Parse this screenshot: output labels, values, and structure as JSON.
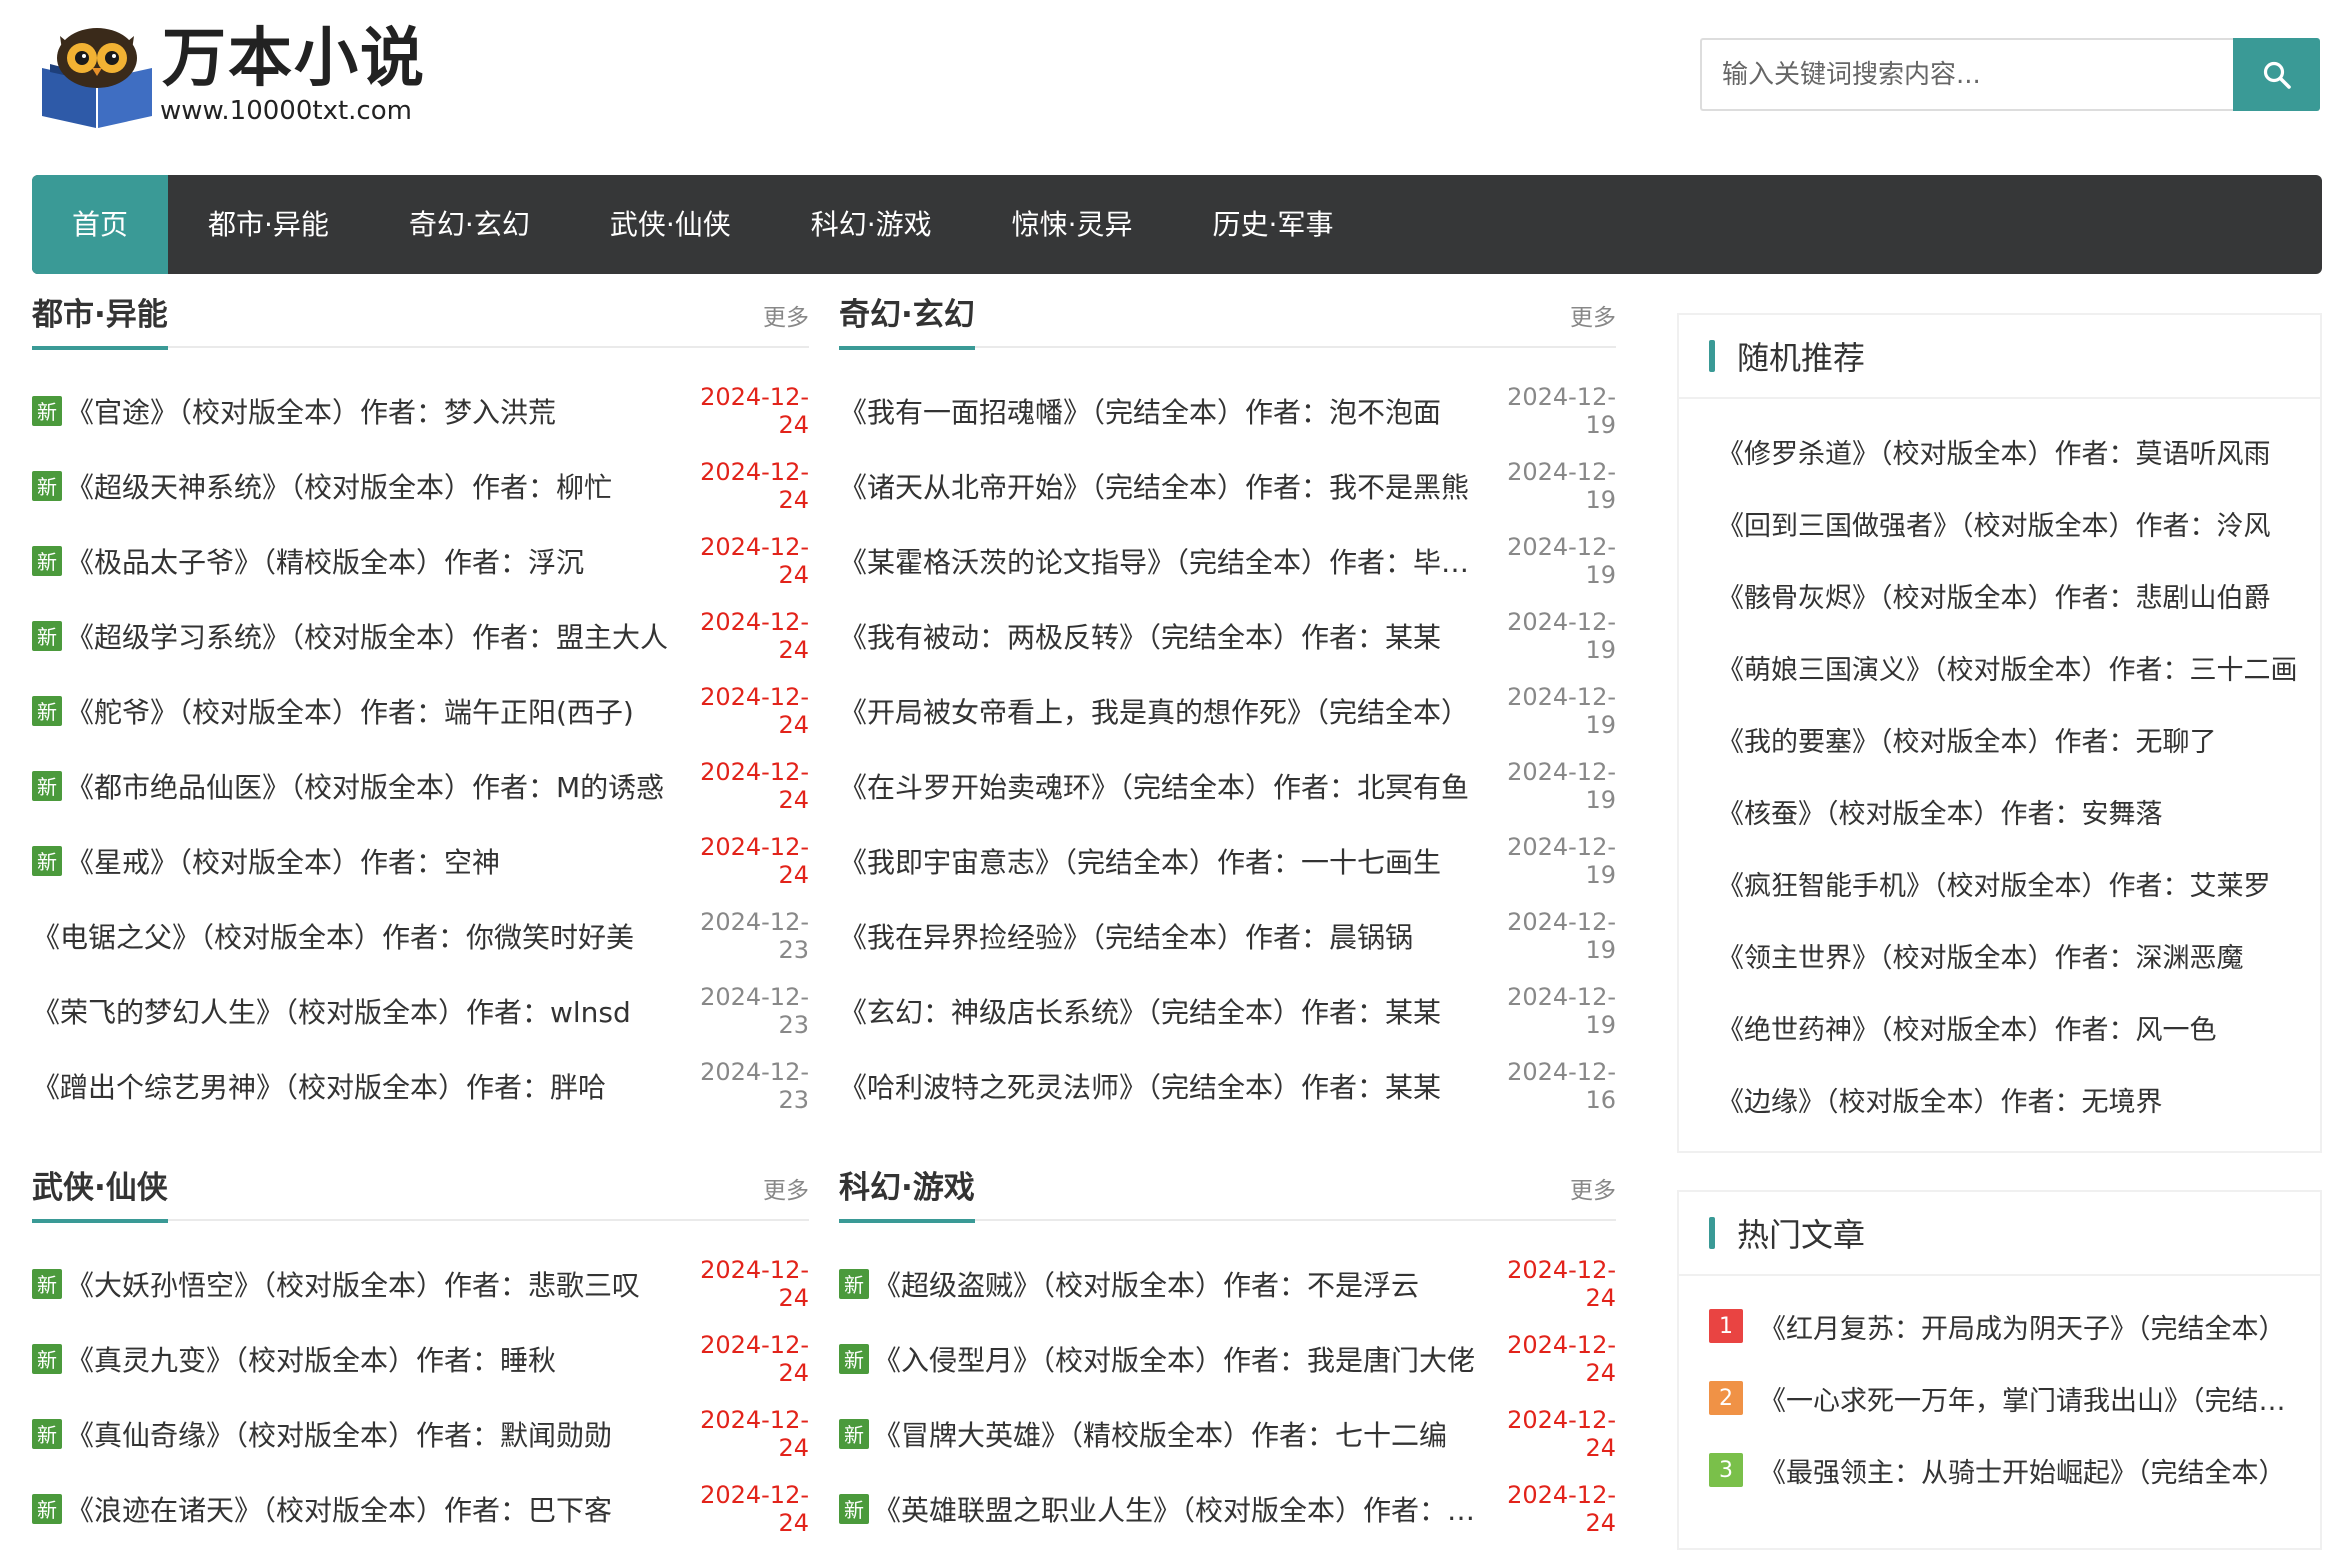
{
  "header": {
    "logo_title": "万本小说",
    "logo_url": "www.10000txt.com",
    "search_placeholder": "输入关键词搜索内容..."
  },
  "colors": {
    "accent": "#3a9a96",
    "nav_bg": "#363738",
    "new_badge": "#4b9a3c",
    "date_red": "#e2231a",
    "rank1": "#e94442",
    "rank2": "#f09246",
    "rank3": "#7ac04a"
  },
  "nav": [
    {
      "label": "首页",
      "active": true
    },
    {
      "label": "都市·异能"
    },
    {
      "label": "奇幻·玄幻"
    },
    {
      "label": "武侠·仙侠"
    },
    {
      "label": "科幻·游戏"
    },
    {
      "label": "惊悚·灵异"
    },
    {
      "label": "历史·军事"
    }
  ],
  "sections": [
    {
      "title": "都市·异能",
      "more": "更多",
      "items": [
        {
          "new": "新",
          "title": "《官途》（校对版全本）作者：梦入洪荒",
          "date": "2024-12-24",
          "red": true
        },
        {
          "new": "新",
          "title": "《超级天神系统》（校对版全本）作者：柳忙",
          "date": "2024-12-24",
          "red": true
        },
        {
          "new": "新",
          "title": "《极品太子爷》（精校版全本）作者：浮沉",
          "date": "2024-12-24",
          "red": true
        },
        {
          "new": "新",
          "title": "《超级学习系统》（校对版全本）作者：盟主大人",
          "date": "2024-12-24",
          "red": true
        },
        {
          "new": "新",
          "title": "《舵爷》（校对版全本）作者：端午正阳(西子)",
          "date": "2024-12-24",
          "red": true
        },
        {
          "new": "新",
          "title": "《都市绝品仙医》（校对版全本）作者：M的诱惑",
          "date": "2024-12-24",
          "red": true
        },
        {
          "new": "新",
          "title": "《星戒》（校对版全本）作者：空神",
          "date": "2024-12-24",
          "red": true
        },
        {
          "title": "《电锯之父》（校对版全本）作者：你微笑时好美",
          "date": "2024-12-23"
        },
        {
          "title": "《荣飞的梦幻人生》（校对版全本）作者：wlnsd",
          "date": "2024-12-23"
        },
        {
          "title": "《蹭出个综艺男神》（校对版全本）作者：胖哈",
          "date": "2024-12-23"
        }
      ]
    },
    {
      "title": "奇幻·玄幻",
      "more": "更多",
      "items": [
        {
          "title": "《我有一面招魂幡》（完结全本）作者：泡不泡面",
          "date": "2024-12-19"
        },
        {
          "title": "《诸天从北帝开始》（完结全本）作者：我不是黑熊",
          "date": "2024-12-19"
        },
        {
          "title": "《某霍格沃茨的论文指导》（完结全本）作者：毕业鸭",
          "date": "2024-12-19"
        },
        {
          "title": "《我有被动：两极反转》（完结全本）作者：某某",
          "date": "2024-12-19"
        },
        {
          "title": "《开局被女帝看上，我是真的想作死》（完结全本）",
          "date": "2024-12-19"
        },
        {
          "title": "《在斗罗开始卖魂环》（完结全本）作者：北冥有鱼",
          "date": "2024-12-19"
        },
        {
          "title": "《我即宇宙意志》（完结全本）作者：一十七画生",
          "date": "2024-12-19"
        },
        {
          "title": "《我在异界捡经验》（完结全本）作者：晨锅锅",
          "date": "2024-12-19"
        },
        {
          "title": "《玄幻：神级店长系统》（完结全本）作者：某某",
          "date": "2024-12-19"
        },
        {
          "title": "《哈利波特之死灵法师》（完结全本）作者：某某",
          "date": "2024-12-16"
        }
      ]
    },
    {
      "title": "武侠·仙侠",
      "more": "更多",
      "items": [
        {
          "new": "新",
          "title": "《大妖孙悟空》（校对版全本）作者：悲歌三叹",
          "date": "2024-12-24",
          "red": true
        },
        {
          "new": "新",
          "title": "《真灵九变》（校对版全本）作者：睡秋",
          "date": "2024-12-24",
          "red": true
        },
        {
          "new": "新",
          "title": "《真仙奇缘》（校对版全本）作者：默闻勋勋",
          "date": "2024-12-24",
          "red": true
        },
        {
          "new": "新",
          "title": "《浪迹在诸天》（校对版全本）作者：巴下客",
          "date": "2024-12-24",
          "red": true
        }
      ]
    },
    {
      "title": "科幻·游戏",
      "more": "更多",
      "items": [
        {
          "new": "新",
          "title": "《超级盗贼》（校对版全本）作者：不是浮云",
          "date": "2024-12-24",
          "red": true
        },
        {
          "new": "新",
          "title": "《入侵型月》（校对版全本）作者：我是唐门大佬",
          "date": "2024-12-24",
          "red": true
        },
        {
          "new": "新",
          "title": "《冒牌大英雄》（精校版全本）作者：七十二编",
          "date": "2024-12-24",
          "red": true
        },
        {
          "new": "新",
          "title": "《英雄联盟之职业人生》（校对版全本）作者：某某",
          "date": "2024-12-24",
          "red": true
        }
      ]
    }
  ],
  "random": {
    "title": "随机推荐",
    "items": [
      "《修罗杀道》（校对版全本）作者：莫语听风雨",
      "《回到三国做强者》（校对版全本）作者：泠风",
      "《骸骨灰烬》（校对版全本）作者：悲剧山伯爵",
      "《萌娘三国演义》（校对版全本）作者：三十二画",
      "《我的要塞》（校对版全本）作者：无聊了",
      "《核蚕》（校对版全本）作者：安舞落",
      "《疯狂智能手机》（校对版全本）作者：艾莱罗",
      "《领主世界》（校对版全本）作者：深渊恶魔",
      "《绝世药神》（校对版全本）作者：风一色",
      "《边缘》（校对版全本）作者：无境界"
    ]
  },
  "hot": {
    "title": "热门文章",
    "items": [
      {
        "rank": "1",
        "text": "《红月复苏：开局成为阴天子》（完结全本）"
      },
      {
        "rank": "2",
        "text": "《一心求死一万年，掌门请我出山》（完结全本）"
      },
      {
        "rank": "3",
        "text": "《最强领主：从骑士开始崛起》（完结全本）"
      }
    ]
  }
}
